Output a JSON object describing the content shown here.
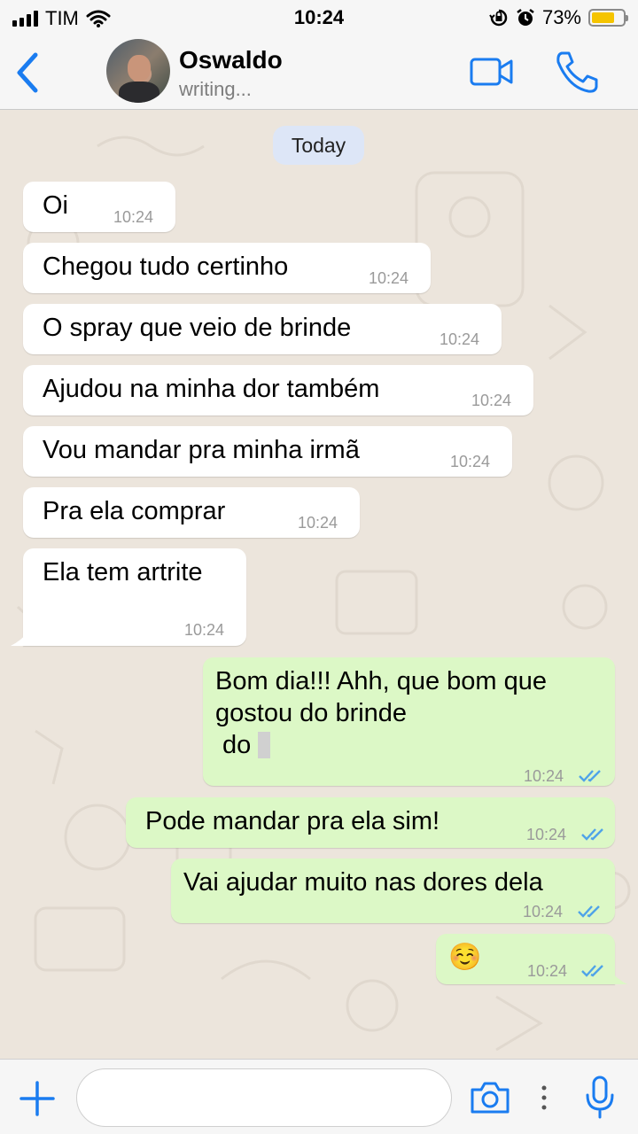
{
  "status_bar": {
    "carrier": "TIM",
    "time": "10:24",
    "battery_percent": "73%",
    "battery_level": 0.73,
    "icons": [
      "signal-icon",
      "wifi-icon",
      "rotation-lock-icon",
      "alarm-icon",
      "battery-icon"
    ]
  },
  "header": {
    "contact_name": "Oswaldo",
    "contact_status": "writing...",
    "accent_color": "#1a7cf0",
    "icons": [
      "back-icon",
      "video-call-icon",
      "phone-call-icon"
    ]
  },
  "chat": {
    "date_label": "Today",
    "incoming": [
      {
        "text": "Oi",
        "time": "10:24"
      },
      {
        "text": "Chegou tudo certinho",
        "time": "10:24"
      },
      {
        "text": "O spray que veio de brinde",
        "time": "10:24"
      },
      {
        "text": "Ajudou na minha dor também",
        "time": "10:24"
      },
      {
        "text": "Vou mandar pra minha irmã",
        "time": "10:24"
      },
      {
        "text": "Pra ela comprar",
        "time": "10:24"
      },
      {
        "text": "Ela tem artrite",
        "time": "10:24"
      }
    ],
    "outgoing": [
      {
        "lines": [
          "Bom dia!!! Ahh, que bom que",
          "gostou do brinde",
          " do"
        ],
        "time": "10:24",
        "status": "read"
      },
      {
        "text": "Pode mandar pra ela sim!",
        "time": "10:24",
        "status": "read"
      },
      {
        "text": "Vai ajudar muito nas dores dela",
        "time": "10:24",
        "status": "read"
      },
      {
        "text": "☺️",
        "time": "10:24",
        "status": "read"
      }
    ],
    "colors": {
      "incoming": "#ffffff",
      "outgoing": "#dcf8c6",
      "read_ticks": "#4fa3e8"
    }
  },
  "composer": {
    "input_value": "",
    "icons": [
      "plus-icon",
      "camera-icon",
      "more-icon",
      "microphone-icon"
    ]
  }
}
